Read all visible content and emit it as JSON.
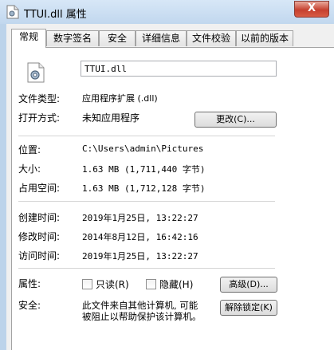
{
  "window": {
    "title": "TTUI.dll 属性",
    "close_glyph": "X"
  },
  "tabs": [
    {
      "label": "常规"
    },
    {
      "label": "数字签名"
    },
    {
      "label": "安全"
    },
    {
      "label": "详细信息"
    },
    {
      "label": "文件校验"
    },
    {
      "label": "以前的版本"
    }
  ],
  "file": {
    "name": "TTUI.dll",
    "icon": "gear-file-icon"
  },
  "fields": {
    "type_label": "文件类型:",
    "type_value": "应用程序扩展 (.dll)",
    "open_label": "打开方式:",
    "open_value": "未知应用程序",
    "change_button": "更改(C)...",
    "location_label": "位置:",
    "location_value": "C:\\Users\\admin\\Pictures",
    "size_label": "大小:",
    "size_value": "1.63 MB (1,711,440 字节)",
    "disk_label": "占用空间:",
    "disk_value": "1.63 MB (1,712,128 字节)",
    "created_label": "创建时间:",
    "created_value": "2019年1月25日, 13:22:27",
    "modified_label": "修改时间:",
    "modified_value": "2014年8月12日, 16:42:16",
    "accessed_label": "访问时间:",
    "accessed_value": "2019年1月25日, 13:22:27",
    "attr_label": "属性:",
    "readonly_label": "只读(R)",
    "hidden_label": "隐藏(H)",
    "advanced_button": "高级(D)...",
    "security_label": "安全:",
    "security_text_1": "此文件来自其他计算机, 可能",
    "security_text_2": "被阻止以帮助保护该计算机。",
    "unblock_button": "解除锁定(K)"
  },
  "colors": {
    "titlebar": "#c7dcf1",
    "close": "#c6402f",
    "panel": "#ffffff"
  }
}
